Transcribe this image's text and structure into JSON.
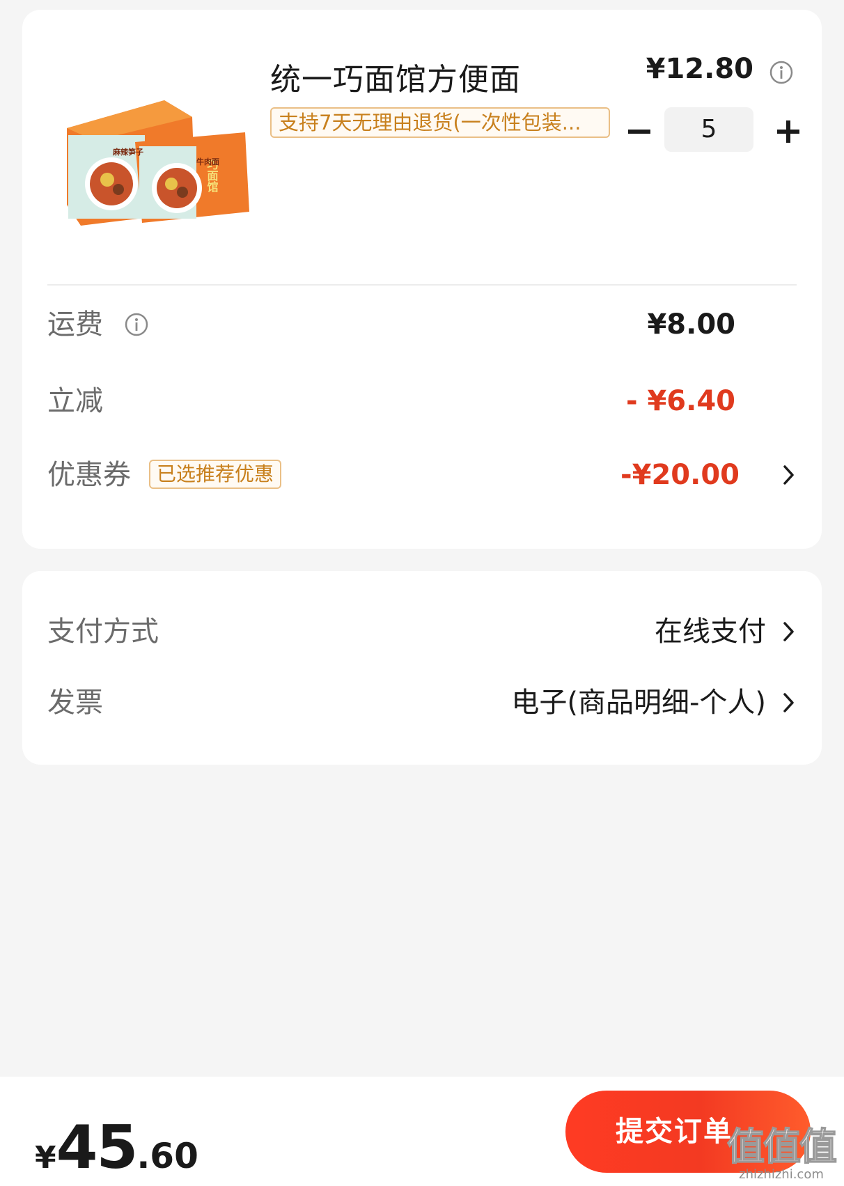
{
  "product": {
    "title": "统一巧面馆方便面",
    "price": "¥12.80",
    "return_tag": "支持7天无理由退货(一次性包装...",
    "quantity": "5",
    "image_text": {
      "brand": "巧面馆",
      "flavor_lines": [
        "麻辣笋子",
        "牛肉面"
      ]
    }
  },
  "fees": {
    "shipping_label": "运费",
    "shipping_value": "¥8.00",
    "discount_label": "立减",
    "discount_value": "- ¥6.40",
    "coupon_label": "优惠券",
    "coupon_tag": "已选推荐优惠",
    "coupon_value": "-¥20.00"
  },
  "payment": {
    "method_label": "支付方式",
    "method_value": "在线支付",
    "invoice_label": "发票",
    "invoice_value": "电子(商品明细-个人)"
  },
  "footer": {
    "currency": "¥",
    "total_int": "45",
    "total_dec": ".60",
    "submit_label": "提交订单"
  },
  "watermark": {
    "main": "值值值",
    "sub": "zhizhizhi.com"
  },
  "colors": {
    "accent_red": "#e03a1e",
    "button_red": "#f33a22",
    "tag_border": "#eabf86",
    "tag_text": "#c8801d",
    "page_bg": "#f5f5f5"
  },
  "icons": [
    "info-icon",
    "minus-icon",
    "plus-icon",
    "chevron-right-icon"
  ]
}
